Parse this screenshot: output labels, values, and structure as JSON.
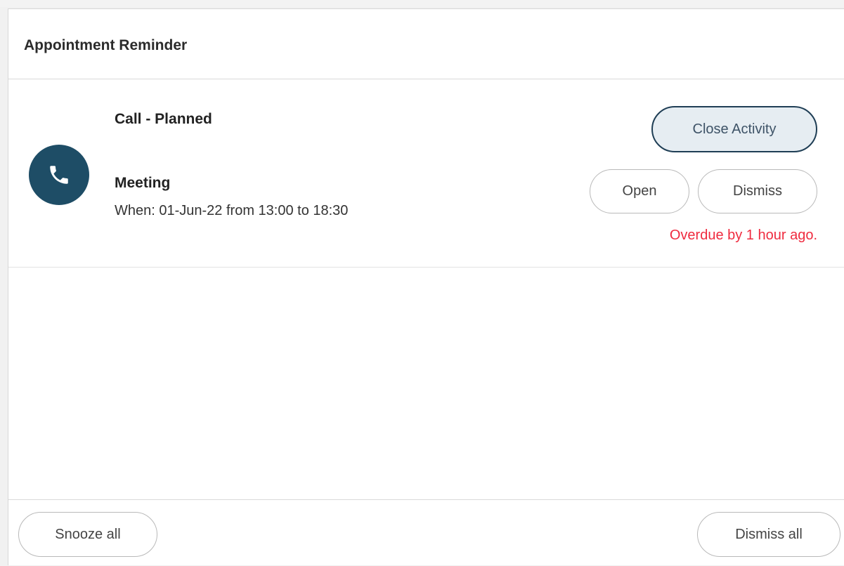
{
  "dialog": {
    "title": "Appointment Reminder"
  },
  "reminder": {
    "icon": "phone-icon",
    "icon_bg_color": "#1e4d66",
    "activity_type": "Call - Planned",
    "subject": "Meeting",
    "when": "When: 01-Jun-22 from 13:00 to 18:30",
    "close_activity_label": "Close Activity",
    "open_label": "Open",
    "dismiss_label": "Dismiss",
    "overdue_text": "Overdue by 1 hour ago.",
    "overdue_color": "#ef2b3f"
  },
  "footer": {
    "snooze_all_label": "Snooze all",
    "dismiss_all_label": "Dismiss all"
  }
}
